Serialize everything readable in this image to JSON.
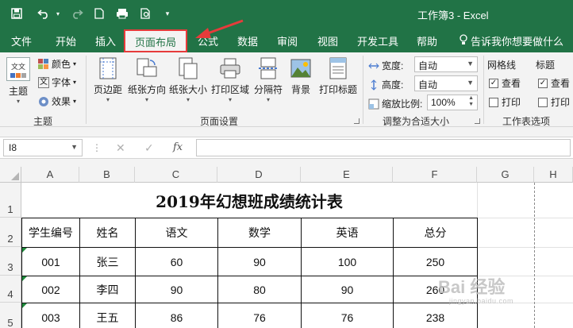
{
  "window": {
    "doc_title": "工作簿3  -  Excel"
  },
  "menu": {
    "tabs": [
      "文件",
      "开始",
      "插入",
      "页面布局",
      "公式",
      "数据",
      "审阅",
      "视图",
      "开发工具",
      "帮助"
    ],
    "active_tab": "页面布局",
    "tell_me": "告诉我你想要做什么"
  },
  "ribbon": {
    "themes": {
      "theme": "主题",
      "colors": "颜色",
      "fonts": "字体",
      "effects": "效果",
      "group": "主题",
      "theme_icon_text": "文文"
    },
    "page_setup": {
      "margins": "页边距",
      "orientation": "纸张方向",
      "size": "纸张大小",
      "print_area": "打印区域",
      "breaks": "分隔符",
      "background": "背景",
      "print_titles": "打印标题",
      "group": "页面设置"
    },
    "scale_to_fit": {
      "width_label": "宽度:",
      "width_value": "自动",
      "height_label": "高度:",
      "height_value": "自动",
      "scale_label": "缩放比例:",
      "scale_value": "100%",
      "group": "调整为合适大小"
    },
    "sheet_options": {
      "gridlines": "网格线",
      "headings": "标题",
      "view": "查看",
      "print": "打印",
      "group": "工作表选项",
      "gridlines_view_checked": true,
      "headings_view_checked": true
    }
  },
  "formula_bar": {
    "name_box": "I8",
    "fx": "fx",
    "formula": ""
  },
  "sheet": {
    "columns": [
      "A",
      "B",
      "C",
      "D",
      "E",
      "F",
      "G",
      "H"
    ],
    "rows": [
      "1",
      "2",
      "3",
      "4",
      "5"
    ],
    "title": "2019年幻想班成绩统计表",
    "headers": [
      "学生编号",
      "姓名",
      "语文",
      "数学",
      "英语",
      "总分"
    ],
    "data": [
      [
        "001",
        "张三",
        "60",
        "90",
        "100",
        "250"
      ],
      [
        "002",
        "李四",
        "90",
        "80",
        "90",
        "260"
      ],
      [
        "003",
        "王五",
        "86",
        "76",
        "76",
        "238"
      ]
    ]
  },
  "watermark": {
    "text": "Bai 经验",
    "sub": "jingyan.baidu.com"
  },
  "colors": {
    "excel_green": "#217346",
    "highlight_red": "#e63b3b",
    "ribbon_bg": "#f3f3f3"
  }
}
